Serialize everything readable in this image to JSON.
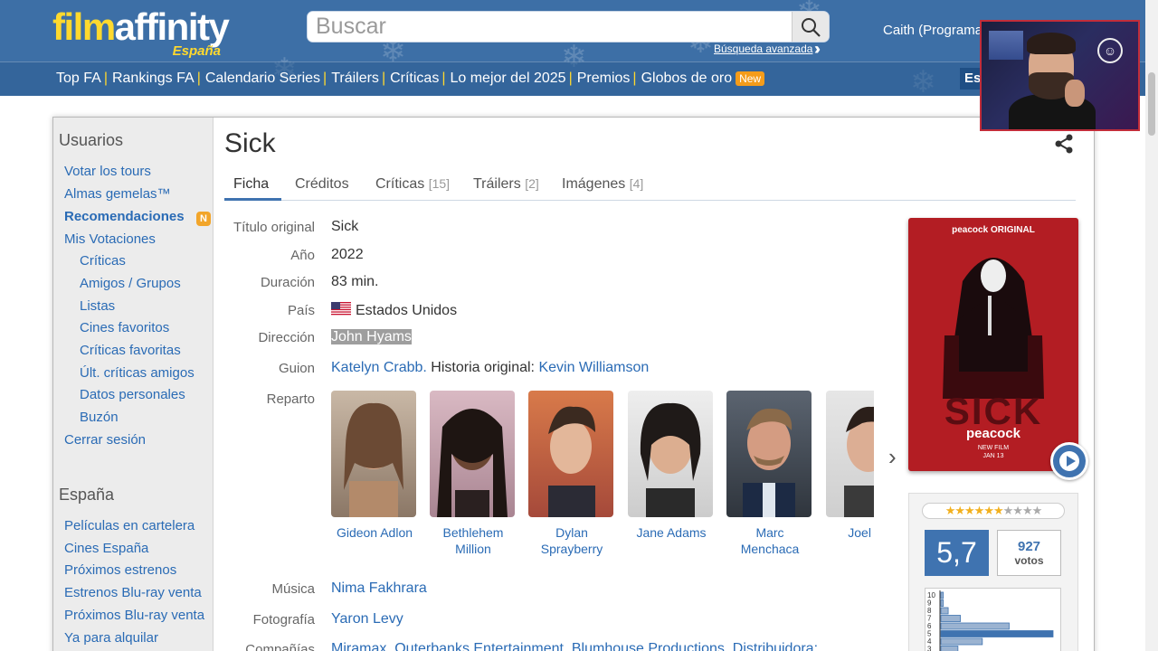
{
  "header": {
    "logo_main_a": "film",
    "logo_main_b": "affinity",
    "logo_sub": "España",
    "search_placeholder": "Buscar",
    "advanced_search": "Búsqueda avanzada",
    "user": "Caith (Programa",
    "lang": "Es"
  },
  "nav": {
    "items": [
      "Top FA",
      "Rankings FA",
      "Calendario Series",
      "Tráilers",
      "Críticas",
      "Lo mejor del 2025",
      "Premios",
      "Globos de oro"
    ],
    "new_badge": "New"
  },
  "sidebar": {
    "users_heading": "Usuarios",
    "users_links": [
      "Votar los tours",
      "Almas gemelas™",
      "Recomendaciones",
      "Mis Votaciones",
      "Críticas",
      "Amigos / Grupos",
      "Listas",
      "Cines favoritos",
      "Críticas favoritas",
      "Últ. críticas amigos",
      "Datos personales",
      "Buzón",
      "Cerrar sesión"
    ],
    "rec_badge": "N",
    "spain_heading": "España",
    "spain_links": [
      "Películas en cartelera",
      "Cines España",
      "Próximos estrenos",
      "Estrenos Blu-ray venta",
      "Próximos Blu-ray venta",
      "Ya para alquilar"
    ]
  },
  "movie": {
    "title": "Sick",
    "tabs": [
      {
        "label": "Ficha",
        "count": ""
      },
      {
        "label": "Créditos",
        "count": ""
      },
      {
        "label": "Críticas",
        "count": "[15]"
      },
      {
        "label": "Tráilers",
        "count": "[2]"
      },
      {
        "label": "Imágenes",
        "count": "[4]"
      }
    ],
    "labels": {
      "original_title": "Título original",
      "year": "Año",
      "duration": "Duración",
      "country": "País",
      "director": "Dirección",
      "script": "Guion",
      "cast": "Reparto",
      "music": "Música",
      "photo": "Fotografía",
      "companies": "Compañías"
    },
    "original_title": "Sick",
    "year": "2022",
    "duration": "83 min.",
    "country": "Estados Unidos",
    "director": "John Hyams",
    "script_writer": "Katelyn Crabb.",
    "script_mid": " Historia original: ",
    "script_original": "Kevin Williamson",
    "cast": [
      {
        "name": "Gideon Adlon"
      },
      {
        "name": "Bethlehem Million"
      },
      {
        "name": "Dylan Sprayberry"
      },
      {
        "name": "Jane Adams"
      },
      {
        "name": "Marc Menchaca"
      },
      {
        "name": "Joel Co"
      }
    ],
    "music": "Nima Fakhrara",
    "photo": "Yaron Levy",
    "companies": "Miramax, Outerbanks Entertainment, Blumhouse Productions. Distribuidora:"
  },
  "poster": {
    "top": "peacock ORIGINAL",
    "title": "SICK",
    "brand": "peacock",
    "small1": "NEW FILM",
    "small2": "JAN 13"
  },
  "rating": {
    "average": "5,7",
    "average_value": 5.7,
    "votes": "927",
    "votes_label": "votos",
    "stars": "★★★★★★★★★★",
    "histogram_labels": [
      "10",
      "9",
      "8",
      "7",
      "6",
      "5",
      "4",
      "3"
    ],
    "histogram_values": [
      1,
      1,
      3,
      8,
      28,
      46,
      17,
      7
    ]
  },
  "colors": {
    "header_bg": "#3d6fa6",
    "accent": "#3f73b0",
    "link": "#2a6bb5",
    "logo_yellow": "#ffd92e",
    "badge_orange": "#f59c1a"
  }
}
